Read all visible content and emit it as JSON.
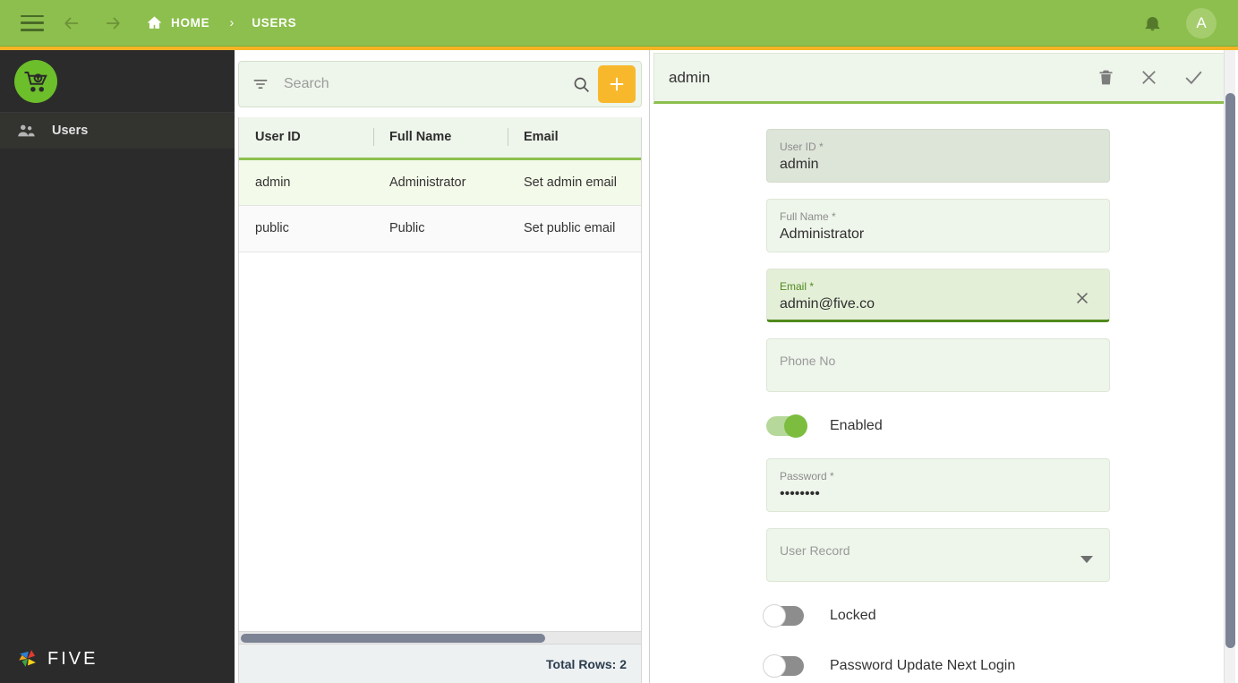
{
  "topbar": {
    "menu_icon": "hamburger-icon",
    "back_icon": "arrow-left-icon",
    "forward_icon": "arrow-right-icon",
    "home_icon": "home-icon",
    "home_label": "HOME",
    "separator": "›",
    "current_label": "USERS",
    "bell_icon": "notification-bell-icon",
    "avatar_initial": "A",
    "bg_color": "#8cbf4d",
    "accent_color": "#f5b324"
  },
  "sidebar": {
    "logo_icon": "shopping-cart-logo",
    "items": [
      {
        "icon": "people-icon",
        "label": "Users"
      }
    ],
    "footer_logo_text": "FIVE",
    "bg_color": "#2b2b2b"
  },
  "list_panel": {
    "search": {
      "filter_icon": "filter-icon",
      "placeholder": "Search",
      "value": "",
      "search_icon": "search-icon",
      "add_icon": "plus-icon",
      "add_button_color": "#f7b82b"
    },
    "table": {
      "columns": [
        "User ID",
        "Full Name",
        "Email"
      ],
      "rows": [
        {
          "user_id": "admin",
          "full_name": "Administrator",
          "email": "Set admin email",
          "selected": true
        },
        {
          "user_id": "public",
          "full_name": "Public",
          "email": "Set public email",
          "selected": false
        }
      ]
    },
    "total_rows_label": "Total Rows: 2"
  },
  "detail_panel": {
    "title": "admin",
    "actions": [
      {
        "icon": "trash-icon",
        "name": "delete-button"
      },
      {
        "icon": "close-icon",
        "name": "close-button"
      },
      {
        "icon": "check-icon",
        "name": "save-button"
      }
    ],
    "fields": [
      {
        "label": "User ID *",
        "value": "admin",
        "state": "disabled"
      },
      {
        "label": "Full Name *",
        "value": "Administrator",
        "state": "normal"
      },
      {
        "label": "Email *",
        "value": "admin@five.co",
        "state": "focused",
        "clear_icon": "close-icon"
      },
      {
        "label": "Phone No",
        "value": "",
        "state": "empty"
      }
    ],
    "enabled_toggle": {
      "label": "Enabled",
      "on": true
    },
    "password_field": {
      "label": "Password *",
      "value": "••••••••",
      "state": "normal"
    },
    "user_record_field": {
      "label": "User Record",
      "value": "",
      "state": "empty",
      "caret_icon": "chevron-down-icon"
    },
    "locked_toggle": {
      "label": "Locked",
      "on": false
    },
    "password_update_toggle": {
      "label": "Password Update Next Login",
      "on": false
    },
    "focus_color": "#4f8a1b"
  }
}
